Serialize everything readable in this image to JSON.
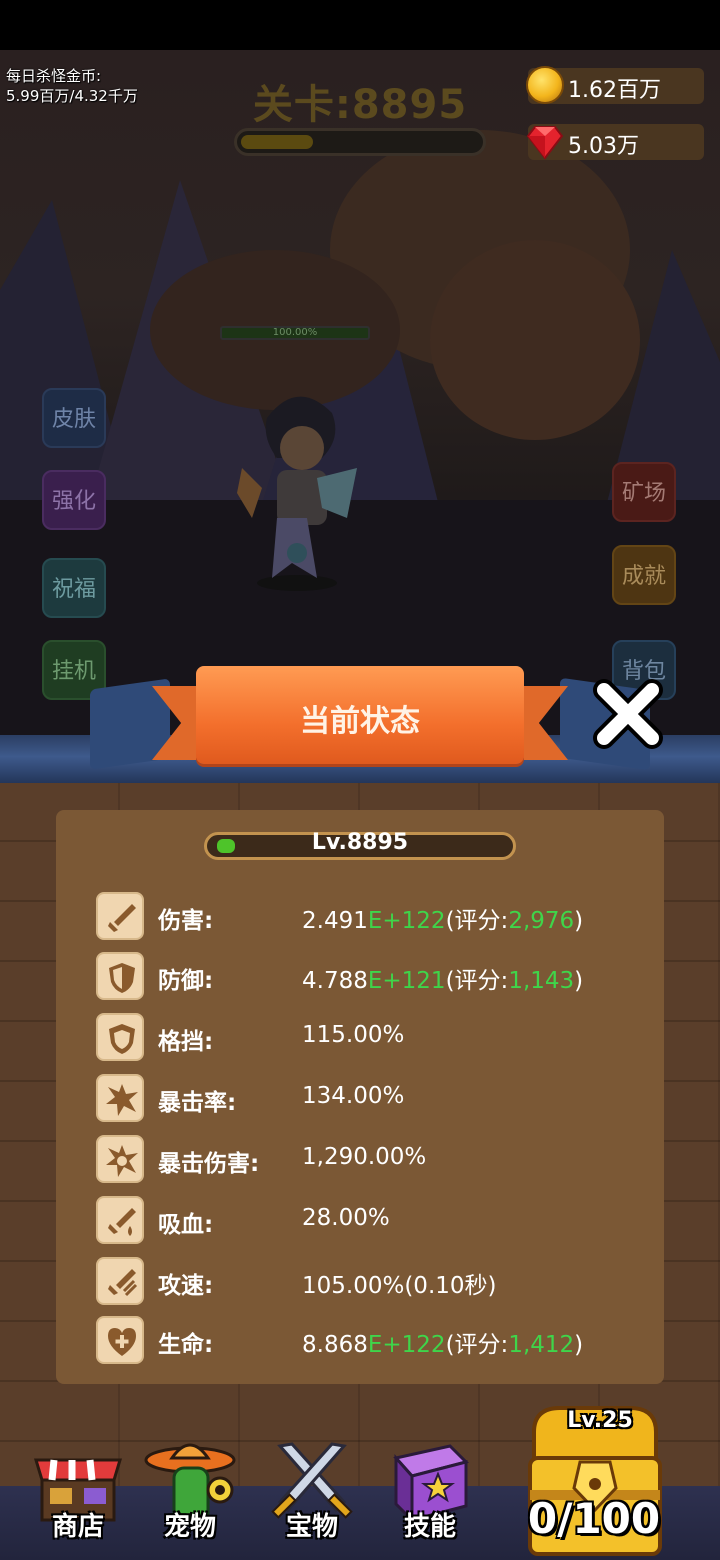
{
  "hud": {
    "daily_gold_label": "每日杀怪金币:",
    "daily_gold_value": "5.99百万/4.32千万",
    "stage_title": "关卡:8895",
    "stage_progress": 0.3,
    "gold": "1.62百万",
    "gems": "5.03万",
    "hero_hp": "100.00%"
  },
  "side_buttons": {
    "skin": "皮肤",
    "enhance": "强化",
    "bless": "祝福",
    "idle": "挂机",
    "mine": "矿场",
    "achievement": "成就",
    "bag": "背包"
  },
  "panel": {
    "title": "当前状态",
    "level": "Lv.8895",
    "level_progress": 0.06,
    "stats": [
      {
        "label": "伤害:",
        "value_prefix": "2.491",
        "value_exp": "E+122",
        "score_open": "(评分:",
        "score": "2,976",
        "score_close": ")"
      },
      {
        "label": "防御:",
        "value_prefix": "4.788",
        "value_exp": "E+121",
        "score_open": "(评分:",
        "score": "1,143",
        "score_close": ")"
      },
      {
        "label": "格挡:",
        "value": "115.00%"
      },
      {
        "label": "暴击率:",
        "value": "134.00%"
      },
      {
        "label": "暴击伤害:",
        "value": "1,290.00%"
      },
      {
        "label": "吸血:",
        "value": "28.00%"
      },
      {
        "label": "攻速:",
        "value": "105.00%(0.10秒)"
      },
      {
        "label": "生命:",
        "value_prefix": "8.868",
        "value_exp": "E+122",
        "score_open": "(评分:",
        "score": "1,412",
        "score_close": ")"
      }
    ]
  },
  "nav": {
    "shop": "商店",
    "pet": "宠物",
    "treasure": "宝物",
    "skill": "技能",
    "chest_level": "Lv.25",
    "chest_count": "0/100"
  },
  "colors": {
    "accent_orange": "#f36f2c",
    "score_green": "#3fd54a",
    "panel_brown": "#7b5835"
  }
}
